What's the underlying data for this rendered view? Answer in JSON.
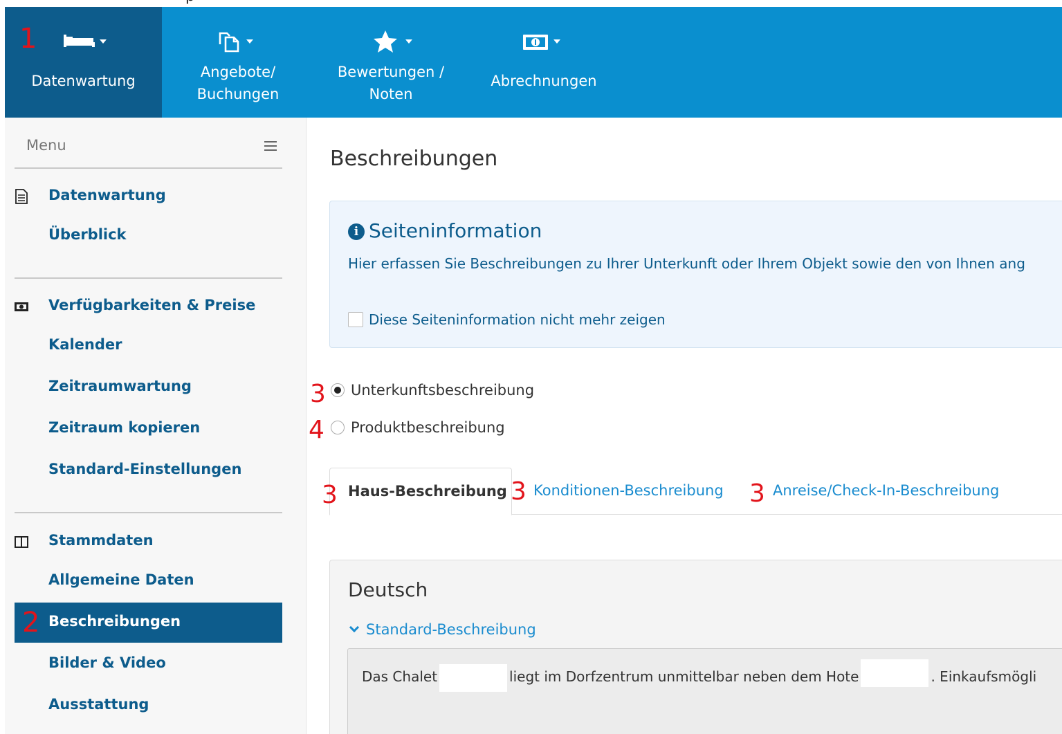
{
  "top_partial_text": "p",
  "topnav": {
    "tabs": [
      {
        "label": "Datenwartung",
        "icon": "bed-icon",
        "active": true
      },
      {
        "label": "Angebote/\nBuchungen",
        "icon": "copy-icon",
        "active": false
      },
      {
        "label": "Bewertungen /\nNoten",
        "icon": "star-icon",
        "active": false
      },
      {
        "label": "Abrechnungen",
        "icon": "money-icon",
        "active": false
      }
    ]
  },
  "sidebar": {
    "menu_label": "Menu",
    "sections": [
      {
        "title": "Datenwartung",
        "icon": "document-icon",
        "items": [
          "Überblick"
        ]
      },
      {
        "title": "Verfügbarkeiten & Preise",
        "icon": "money-icon",
        "items": [
          "Kalender",
          "Zeitraumwartung",
          "Zeitraum kopieren",
          "Standard-Einstellungen"
        ]
      },
      {
        "title": "Stammdaten",
        "icon": "columns-icon",
        "items": [
          "Allgemeine Daten",
          "Beschreibungen",
          "Bilder & Video",
          "Ausstattung"
        ]
      }
    ],
    "active_item": "Beschreibungen"
  },
  "main": {
    "page_title": "Beschreibungen",
    "info": {
      "title": "Seiteninformation",
      "text": "Hier erfassen Sie Beschreibungen zu Ihrer Unterkunft oder Ihrem Objekt sowie den von Ihnen ang",
      "checkbox_label": "Diese Seiteninformation nicht mehr zeigen",
      "checkbox_checked": false
    },
    "radios": [
      {
        "label": "Unterkunftsbeschreibung",
        "checked": true
      },
      {
        "label": "Produktbeschreibung",
        "checked": false
      }
    ],
    "tabs": [
      {
        "label": "Haus-Beschreibung",
        "active": true
      },
      {
        "label": "Konditionen-Beschreibung",
        "active": false
      },
      {
        "label": "Anreise/Check-In-Beschreibung",
        "active": false
      }
    ],
    "language_panel": {
      "language": "Deutsch",
      "collapsible_label": "Standard-Beschreibung",
      "text_part1": "Das Chalet",
      "text_part2": "liegt im Dorfzentrum unmittelbar neben dem Hote",
      "text_part3": ". Einkaufsmögli"
    }
  },
  "annotations": {
    "nav": "1",
    "sidebar": "2",
    "radio1": "3",
    "radio2": "4",
    "tab1": "3",
    "tab2": "3",
    "tab3": "3"
  },
  "colors": {
    "nav_bg": "#0a8fcf",
    "nav_active": "#0d5c8c",
    "link": "#1a8ccf",
    "annotation": "#e2141b"
  }
}
